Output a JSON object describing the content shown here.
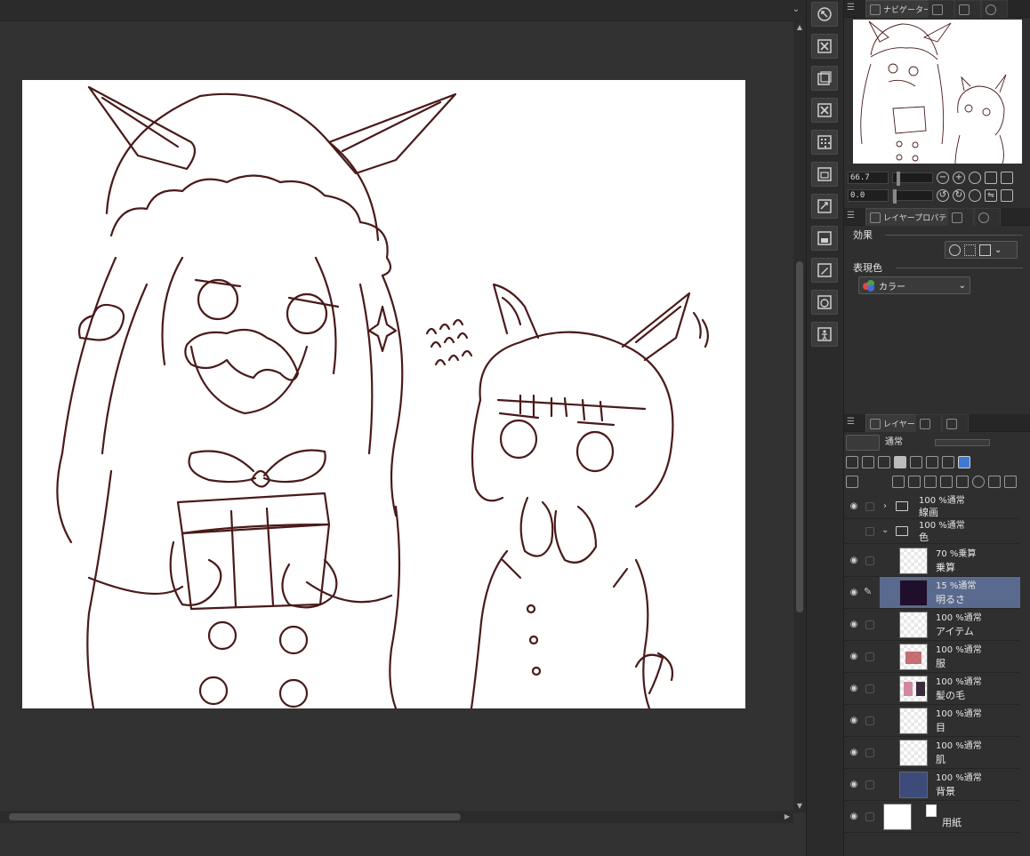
{
  "colors": {
    "canvas_bg": "#323232",
    "paper": "#ffffff",
    "line_art": "#4a1a1a",
    "panel_bg": "#2f2f2f",
    "selected_layer": "#5a6a8e",
    "selected_thumb": "#1f0e2c",
    "bg_thumb": "#3c4b7a"
  },
  "canvas": {
    "top_chevron": "⌄",
    "vscroll_up": "▲",
    "vscroll_down": "▼",
    "hscroll_right": "▶"
  },
  "toolstrip": {
    "icons": [
      "navigator-icon",
      "close-icon",
      "layer-icon",
      "close-icon",
      "pattern-icon",
      "layer-copy-icon",
      "transform-icon",
      "layer-save-icon",
      "edit-icon",
      "material-icon",
      "figure-icon"
    ]
  },
  "navigator": {
    "menu_icon": "☰",
    "tab_label": "ナビゲーター",
    "zoom_value": "66.7",
    "rotate_value": "0.0",
    "zoom_out": "−",
    "zoom_in": "+",
    "rotate_left": "↺",
    "rotate_right": "↻",
    "flip": "⇋"
  },
  "layer_property": {
    "menu_icon": "☰",
    "tab_label": "レイヤープロパティ",
    "effect_label": "効果",
    "expression_label": "表現色",
    "expression_value": "カラー",
    "dropdown_arrow": "⌄"
  },
  "layers_panel": {
    "menu_icon": "☰",
    "tab_label": "レイヤー",
    "blend_mode": "通常",
    "rows": [
      {
        "kind": "folder",
        "mode": "100 %通常",
        "name": "線画",
        "expanded": false,
        "chevron": "›",
        "eye": "◉"
      },
      {
        "kind": "folder",
        "mode": "100 %通常",
        "name": "色",
        "expanded": true,
        "chevron": "⌄",
        "eye": ""
      },
      {
        "kind": "layer",
        "mode": "70 %乗算",
        "name": "乗算",
        "eye": "◉"
      },
      {
        "kind": "layer",
        "mode": "15 %通常",
        "name": "明るさ",
        "eye": "◉",
        "selected": true
      },
      {
        "kind": "layer",
        "mode": "100 %通常",
        "name": "アイテム",
        "eye": "◉"
      },
      {
        "kind": "layer",
        "mode": "100 %通常",
        "name": "服",
        "eye": "◉"
      },
      {
        "kind": "layer",
        "mode": "100 %通常",
        "name": "髪の毛",
        "eye": "◉"
      },
      {
        "kind": "layer",
        "mode": "100 %通常",
        "name": "目",
        "eye": "◉"
      },
      {
        "kind": "layer",
        "mode": "100 %通常",
        "name": "肌",
        "eye": "◉"
      },
      {
        "kind": "layer",
        "mode": "100 %通常",
        "name": "背景",
        "eye": "◉"
      },
      {
        "kind": "paper",
        "mode": "",
        "name": "用紙",
        "eye": "◉"
      }
    ]
  }
}
